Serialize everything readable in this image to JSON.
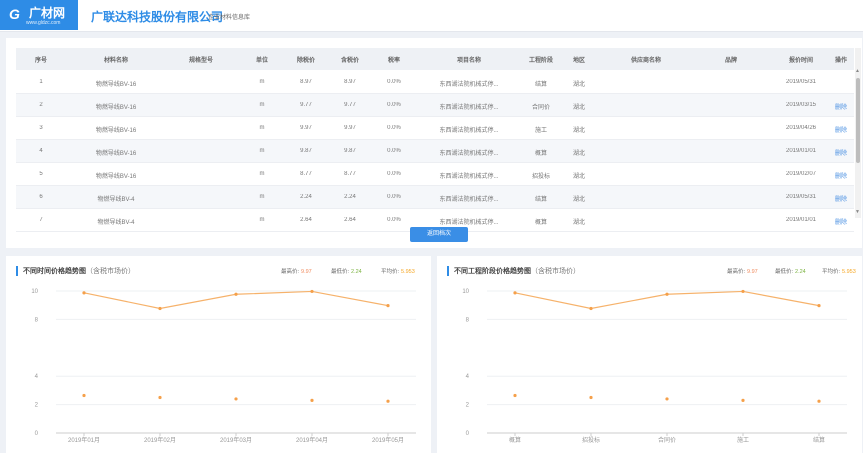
{
  "header": {
    "logo_mark": "G",
    "logo_text": "广材网",
    "logo_url": "www.gldzc.com",
    "company": "广联达科技股份有限公司",
    "subtitle": "企业材料信息库"
  },
  "table": {
    "columns": [
      "序号",
      "材料名称",
      "规格型号",
      "单位",
      "除税价",
      "含税价",
      "税率",
      "项目名称",
      "工程阶段",
      "地区",
      "供应商名称",
      "品牌",
      "报价时间",
      "操作"
    ],
    "rows": [
      [
        "1",
        "物燃导线BV-16",
        "",
        "m",
        "8.97",
        "8.97",
        "0.0%",
        "东西湖法院机械式停...",
        "结算",
        "湖北",
        "",
        "",
        "2019/05/31",
        ""
      ],
      [
        "2",
        "物燃导线BV-16",
        "",
        "m",
        "9.77",
        "9.77",
        "0.0%",
        "东西湖法院机械式停...",
        "合同价",
        "湖北",
        "",
        "",
        "2019/03/15",
        "删除"
      ],
      [
        "3",
        "物燃导线BV-16",
        "",
        "m",
        "9.97",
        "9.97",
        "0.0%",
        "东西湖法院机械式停...",
        "施工",
        "湖北",
        "",
        "",
        "2019/04/26",
        "删除"
      ],
      [
        "4",
        "物燃导线BV-16",
        "",
        "m",
        "9.87",
        "9.87",
        "0.0%",
        "东西湖法院机械式停...",
        "概算",
        "湖北",
        "",
        "",
        "2019/01/01",
        "删除"
      ],
      [
        "5",
        "物燃导线BV-16",
        "",
        "m",
        "8.77",
        "8.77",
        "0.0%",
        "东西湖法院机械式停...",
        "招投标",
        "湖北",
        "",
        "",
        "2019/02/07",
        "删除"
      ],
      [
        "6",
        "物燃导线BV-4",
        "",
        "m",
        "2.24",
        "2.24",
        "0.0%",
        "东西湖法院机械式停...",
        "结算",
        "湖北",
        "",
        "",
        "2019/05/31",
        "删除"
      ],
      [
        "7",
        "物燃导线BV-4",
        "",
        "m",
        "2.64",
        "2.64",
        "0.0%",
        "东西湖法院机械式停...",
        "概算",
        "湖北",
        "",
        "",
        "2019/01/01",
        "删除"
      ]
    ],
    "scroll_up": "▲",
    "scroll_down": "▼",
    "return_button": "返回档次"
  },
  "charts": {
    "left": {
      "title": "不同时间价格趋势图",
      "note": "（含税市场价）",
      "max_label": "最高价:",
      "max_value": "9.97",
      "min_label": "最低价:",
      "min_value": "2.24",
      "avg_label": "平均价:",
      "avg_value": "5.953"
    },
    "right": {
      "title": "不同工程阶段价格趋势图",
      "note": "（含税市场价）",
      "max_label": "最高价:",
      "max_value": "9.97",
      "min_label": "最低价:",
      "min_value": "2.24",
      "avg_label": "平均价:",
      "avg_value": "5.953"
    }
  },
  "colors": {
    "accent": "#2e8ce6",
    "line": "#f6b26b",
    "max": "#f08a5d",
    "min": "#7cb342",
    "avg": "#f5a623"
  },
  "chart_data": [
    {
      "type": "line",
      "categories": [
        "2019年01月",
        "2019年02月",
        "2019年03月",
        "2019年04月",
        "2019年05月"
      ],
      "series": [
        {
          "values": [
            9.87,
            8.77,
            9.77,
            9.97,
            8.97
          ]
        },
        {
          "values": [
            2.64,
            2.5,
            2.4,
            2.3,
            2.24
          ]
        }
      ],
      "yticks": [
        0,
        2,
        4,
        8,
        10
      ],
      "ylim": [
        0,
        10
      ]
    },
    {
      "type": "line",
      "categories": [
        "概算",
        "招投标",
        "合同价",
        "施工",
        "结算"
      ],
      "series": [
        {
          "values": [
            9.87,
            8.77,
            9.77,
            9.97,
            8.97
          ]
        },
        {
          "values": [
            2.64,
            2.5,
            2.4,
            2.3,
            2.24
          ]
        }
      ],
      "yticks": [
        0,
        2,
        4,
        8,
        10
      ],
      "ylim": [
        0,
        10
      ]
    }
  ]
}
